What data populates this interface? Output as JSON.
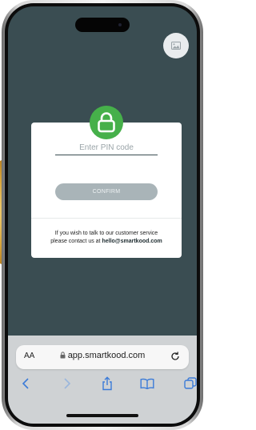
{
  "pin_card": {
    "pin_placeholder": "Enter PIN code",
    "confirm_label": "CONFIRM",
    "contact_line1": "If you wish to talk to our customer service",
    "contact_line2_prefix": "please contact us at ",
    "contact_email": "hello@smartkood.com"
  },
  "browser": {
    "text_size_label": "AA",
    "url": "app.smartkood.com"
  },
  "colors": {
    "page_background": "#3a4d52",
    "lock_badge": "#46b04a",
    "confirm_button": "#a9b4b8",
    "browser_bar": "#cfd2d4",
    "toolbar_icon": "#3b7bd8"
  },
  "icons": {
    "image_button": "image-icon",
    "card_badge": "lock-icon",
    "url_lock": "lock-icon",
    "reload": "reload-icon",
    "toolbar": [
      "back-icon",
      "forward-icon",
      "share-icon",
      "bookmarks-icon",
      "tabs-icon"
    ]
  }
}
